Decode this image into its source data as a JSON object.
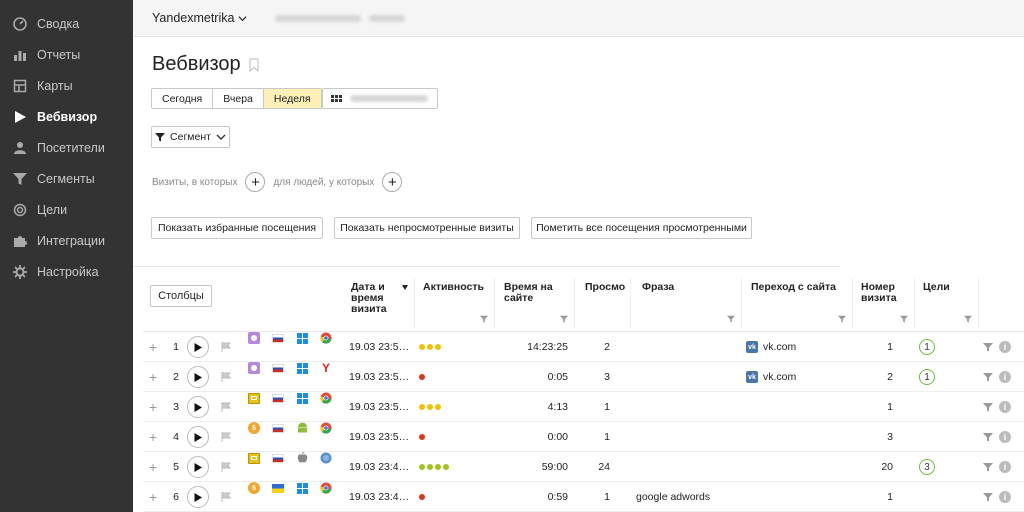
{
  "sidebar": {
    "items": [
      {
        "label": "Сводка",
        "icon": "dashboard-icon"
      },
      {
        "label": "Отчеты",
        "icon": "bar-chart-icon"
      },
      {
        "label": "Карты",
        "icon": "map-icon"
      },
      {
        "label": "Вебвизор",
        "icon": "play-icon",
        "active": true
      },
      {
        "label": "Посетители",
        "icon": "user-icon"
      },
      {
        "label": "Сегменты",
        "icon": "funnel-icon"
      },
      {
        "label": "Цели",
        "icon": "target-icon"
      },
      {
        "label": "Интеграции",
        "icon": "puzzle-icon"
      },
      {
        "label": "Настройка",
        "icon": "gear-icon"
      }
    ]
  },
  "topbar": {
    "counter_name": "Yandexmetrika"
  },
  "page": {
    "title": "Вебвизор"
  },
  "period": {
    "today": "Сегодня",
    "yesterday": "Вчера",
    "week": "Неделя",
    "active": "Неделя"
  },
  "segment_button": "Сегмент",
  "conditions": {
    "visits_label": "Визиты, в которых",
    "people_label": "для людей, у которых",
    "plus": "+"
  },
  "actions": {
    "show_favorites": "Показать избранные посещения",
    "show_unviewed": "Показать непросмотренные визиты",
    "mark_all_viewed": "Пометить все посещения просмотренными"
  },
  "table": {
    "columns_button": "Столбцы",
    "headers": {
      "datetime": "Дата и время визита",
      "activity": "Активность",
      "time_on_site": "Время на сайте",
      "views": "Просмо",
      "phrase": "Фраза",
      "referrer": "Переход с сайта",
      "visit_number": "Номер визита",
      "goals": "Цели"
    },
    "rows": [
      {
        "num": "1",
        "source": "direct-icon",
        "country": "ru",
        "os": "windows-icon",
        "browser": "chrome-icon",
        "datetime": "19.03 23:5…",
        "activity": 3,
        "activity_color": "#f2c200",
        "time": "14:23:25",
        "views": "2",
        "phrase": "",
        "referrer": "vk.com",
        "visit_number": "1",
        "goals": "1"
      },
      {
        "num": "2",
        "source": "direct-icon",
        "country": "ru",
        "os": "windows-icon",
        "browser": "yandex-browser-icon",
        "datetime": "19.03 23:5…",
        "activity": 1,
        "activity_color": "#e2331c",
        "time": "0:05",
        "views": "3",
        "phrase": "",
        "referrer": "vk.com",
        "visit_number": "2",
        "goals": "1"
      },
      {
        "num": "3",
        "source": "internal-icon",
        "country": "ru",
        "os": "windows-icon",
        "browser": "chrome-icon",
        "datetime": "19.03 23:5…",
        "activity": 3,
        "activity_color": "#f2c200",
        "time": "4:13",
        "views": "1",
        "phrase": "",
        "referrer": "",
        "visit_number": "1",
        "goals": ""
      },
      {
        "num": "4",
        "source": "search-icon",
        "country": "ru",
        "os": "android-icon",
        "browser": "chrome-icon",
        "datetime": "19.03 23:5…",
        "activity": 1,
        "activity_color": "#e2331c",
        "time": "0:00",
        "views": "1",
        "phrase": "",
        "referrer": "",
        "visit_number": "3",
        "goals": ""
      },
      {
        "num": "5",
        "source": "internal-icon",
        "country": "ru",
        "os": "apple-icon",
        "browser": "globe-icon",
        "datetime": "19.03 23:4…",
        "activity": 4,
        "activity_color": "#a3c31e",
        "time": "59:00",
        "views": "24",
        "phrase": "",
        "referrer": "",
        "visit_number": "20",
        "goals": "3"
      },
      {
        "num": "6",
        "source": "search-icon",
        "country": "ua",
        "os": "windows-icon",
        "browser": "chrome-icon",
        "datetime": "19.03 23:4…",
        "activity": 1,
        "activity_color": "#e2331c",
        "time": "0:59",
        "views": "1",
        "phrase": "google adwords",
        "referrer": "",
        "visit_number": "1",
        "goals": ""
      }
    ]
  }
}
